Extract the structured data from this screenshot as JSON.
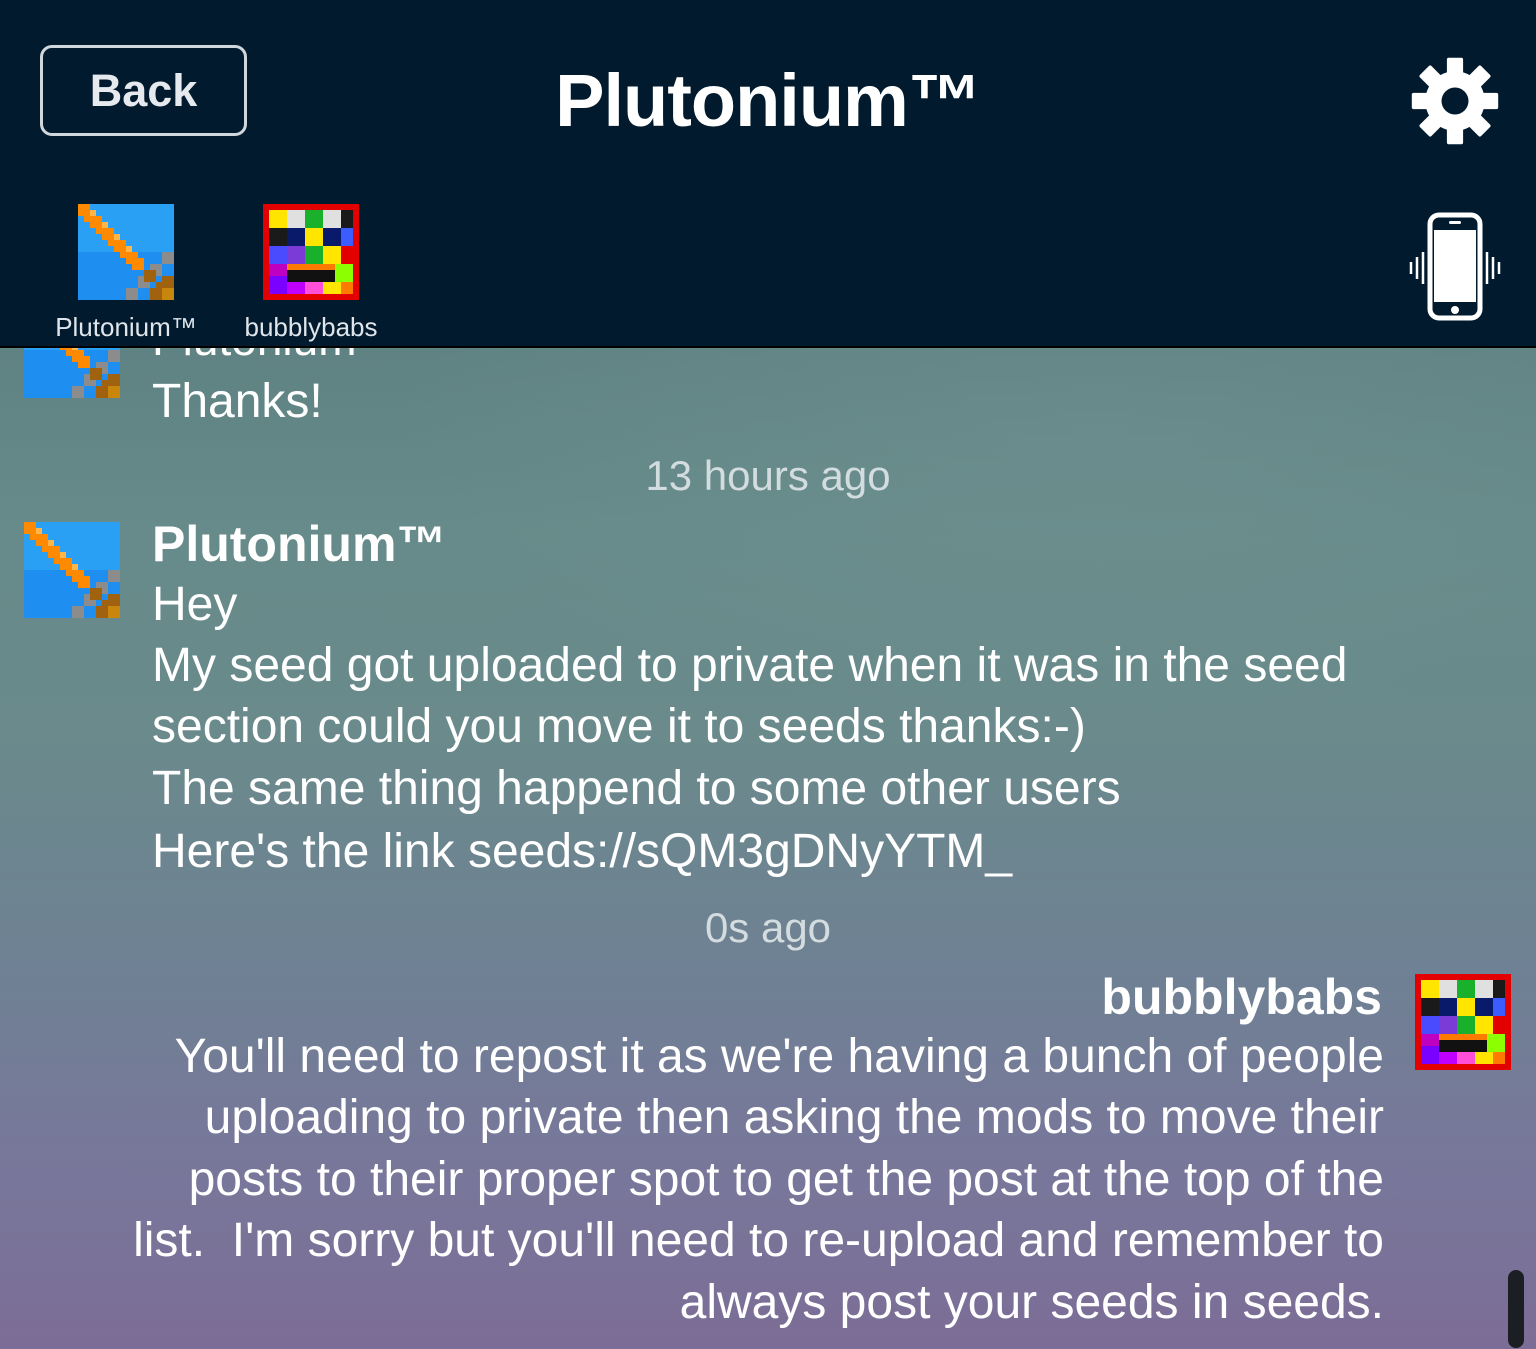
{
  "header": {
    "back_label": "Back",
    "title": "Plutonium™",
    "settings_icon": "gear-icon",
    "vibrate_icon": "phone-vibrate-icon"
  },
  "participants": [
    {
      "name": "Plutonium™",
      "avatar": "sword-pixel-avatar"
    },
    {
      "name": "bubblybabs",
      "avatar": "smiley-pixel-avatar"
    }
  ],
  "chat": {
    "prev_message_tail": "Thanks!",
    "groups": [
      {
        "timestamp": "13 hours ago",
        "sender": "Plutonium™",
        "lines": [
          "Hey",
          "My seed got uploaded to private when it was in the seed",
          "section could you move it to seeds thanks:-)",
          "The same thing happend to some other users",
          "Here's the link seeds://sQM3gDNyYTM_"
        ]
      },
      {
        "timestamp": "0s ago",
        "sender": "bubblybabs",
        "lines": [
          "You'll need to repost it as we're having a bunch of people",
          "uploading to private then asking the mods to move their",
          "posts to their proper spot to get the post at the top of the",
          "list.  I'm sorry but you'll need to re-upload and remember to",
          "always post your seeds in seeds."
        ]
      }
    ]
  },
  "colors": {
    "header_bg": "#011a2d",
    "chat_top": "#5f8283",
    "chat_bottom": "#7c6d96",
    "text": "#ffffff",
    "timestamp": "#d3dcdf"
  }
}
